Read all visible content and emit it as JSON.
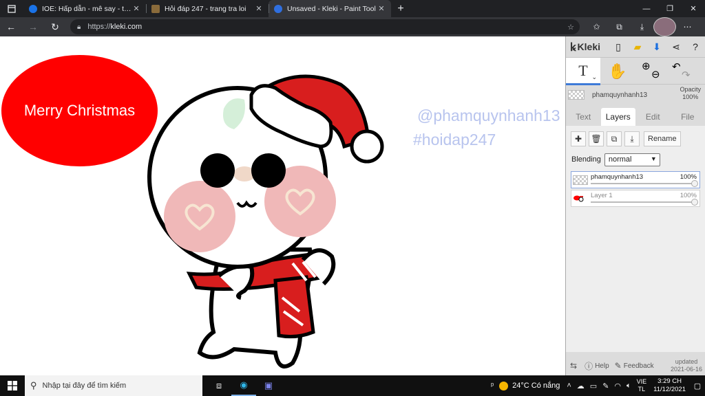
{
  "browser": {
    "tabs": [
      {
        "title": "IOE: Hấp dẫn - mê say - thấy ngợi",
        "close": "✕",
        "favicon_color": "#1a73e8"
      },
      {
        "title": "Hỏi đáp 247 - trang tra loi",
        "close": "✕",
        "favicon_color": "#8a6b3b"
      },
      {
        "title": "Unsaved - Kleki - Paint Tool",
        "close": "✕",
        "favicon_color": "#2f6fe0"
      }
    ],
    "new_tab": "+",
    "url_scheme": "https://",
    "url_host": "kleki.com",
    "window_controls": [
      "—",
      "❐",
      "✕"
    ]
  },
  "canvas": {
    "bubble_text": "Merry Christmas",
    "watermark_1": "@phamquynhanh13",
    "watermark_2": "#hoidap247",
    "colors": {
      "bubble": "#ff0000",
      "watermark": "#b8c4ee",
      "hat": "#d81e1e",
      "cheeks": "#f0b8b8"
    }
  },
  "kleki": {
    "logo": "Kleki",
    "active_layer_name": "phamquynhanh13",
    "opacity_label": "Opacity",
    "opacity_value": "100%",
    "tabs": [
      "Text",
      "Layers",
      "Edit",
      "File"
    ],
    "active_tab": "Layers",
    "rename_label": "Rename",
    "blending_label": "Blending",
    "blending_value": "normal",
    "layers": [
      {
        "name": "phamquynhanh13",
        "opacity": "100%",
        "selected": true
      },
      {
        "name": "Layer 1",
        "opacity": "100%",
        "selected": false
      }
    ],
    "footer": {
      "help": "Help",
      "feedback": "Feedback",
      "updated_label": "updated",
      "updated_date": "2021-06-16"
    },
    "accent": "#3d7ad8"
  },
  "taskbar": {
    "search_placeholder": "Nhập tại đây để tìm kiếm",
    "temperature": "24°C",
    "weather_text": "Có nắng",
    "lang_1": "VIE",
    "lang_2": "TL",
    "time": "3:29 CH",
    "date": "11/12/2021"
  }
}
